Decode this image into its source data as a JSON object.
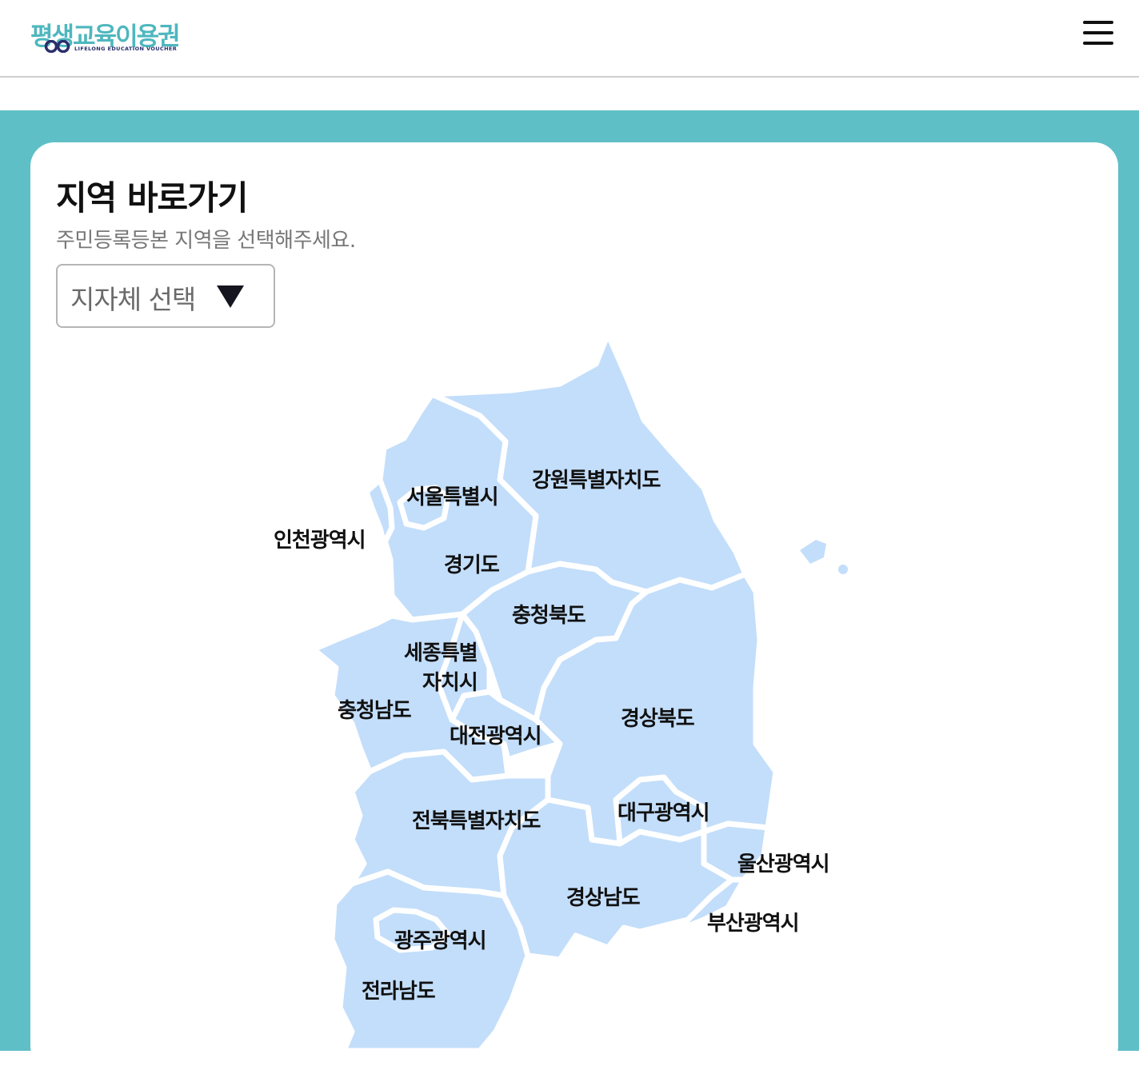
{
  "header": {
    "logo_text": "평생교육이용권",
    "logo_subtitle": "LIFELONG EDUCATION VOUCHER",
    "menu_icon": "hamburger-menu-icon"
  },
  "region_shortcut": {
    "title": "지역 바로가기",
    "subtitle": "주민등록등본 지역을 선택해주세요.",
    "select_placeholder": "지자체 선택",
    "select_icon": "triangle-down-icon"
  },
  "map": {
    "fill_color": "#c3defa",
    "border_color": "#ffffff",
    "regions": [
      {
        "id": "seoul",
        "label": "서울특별시"
      },
      {
        "id": "gangwon",
        "label": "강원특별자치도"
      },
      {
        "id": "incheon",
        "label": "인천광역시"
      },
      {
        "id": "gyeonggi",
        "label": "경기도"
      },
      {
        "id": "chungbuk",
        "label": "충청북도"
      },
      {
        "id": "sejong",
        "label": "세종특별",
        "label_line2": "자치시"
      },
      {
        "id": "chungnam",
        "label": "충청남도"
      },
      {
        "id": "daejeon",
        "label": "대전광역시"
      },
      {
        "id": "gyeongbuk",
        "label": "경상북도"
      },
      {
        "id": "daegu",
        "label": "대구광역시"
      },
      {
        "id": "jeonbuk",
        "label": "전북특별자치도"
      },
      {
        "id": "ulsan",
        "label": "울산광역시"
      },
      {
        "id": "gyeongnam",
        "label": "경상남도"
      },
      {
        "id": "busan",
        "label": "부산광역시"
      },
      {
        "id": "gwangju",
        "label": "광주광역시"
      },
      {
        "id": "jeonnam",
        "label": "전라남도"
      }
    ]
  },
  "colors": {
    "brand_teal": "#5fbfc7",
    "logo_teal": "#4eb7be",
    "logo_navy": "#2a2e6b",
    "map_fill": "#c3defa"
  }
}
